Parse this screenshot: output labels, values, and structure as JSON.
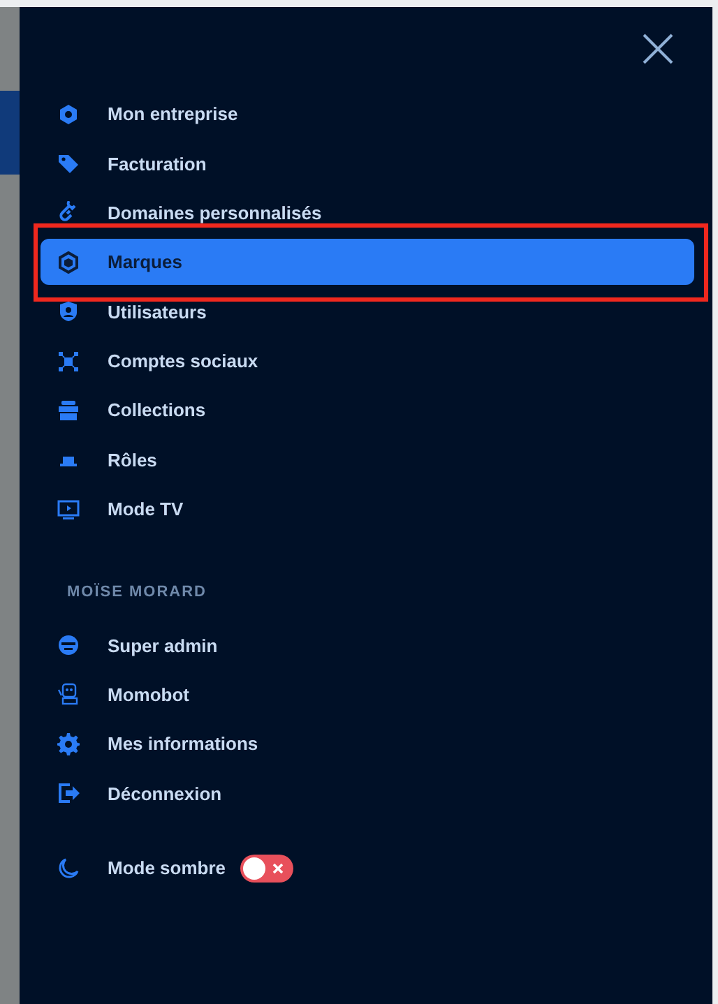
{
  "menu": {
    "items": [
      {
        "label": "Mon entreprise",
        "selected": false
      },
      {
        "label": "Facturation",
        "selected": false
      },
      {
        "label": "Domaines personnalisés",
        "selected": false
      },
      {
        "label": "Marques",
        "selected": true
      },
      {
        "label": "Utilisateurs",
        "selected": false
      },
      {
        "label": "Comptes sociaux",
        "selected": false
      },
      {
        "label": "Collections",
        "selected": false
      },
      {
        "label": "Rôles",
        "selected": false
      },
      {
        "label": "Mode TV",
        "selected": false
      }
    ]
  },
  "user_section": {
    "title": "MOÏSE MORARD",
    "items": [
      {
        "label": "Super admin",
        "selected": false
      },
      {
        "label": "Momobot",
        "selected": false
      },
      {
        "label": "Mes informations",
        "selected": false
      },
      {
        "label": "Déconnexion",
        "selected": false
      }
    ]
  },
  "dark_mode": {
    "label": "Mode sombre",
    "on": false
  }
}
